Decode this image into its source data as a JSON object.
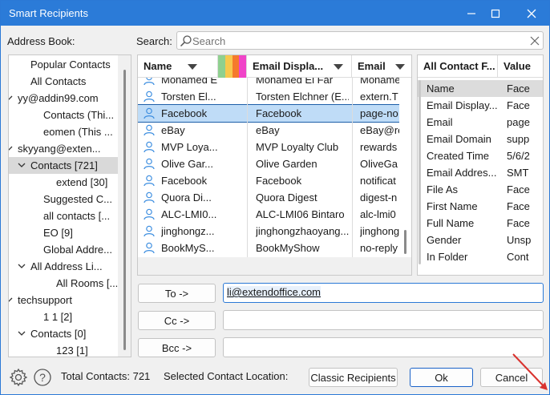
{
  "window": {
    "title": "Smart Recipients"
  },
  "labels": {
    "address_book": "Address Book:",
    "search": "Search:"
  },
  "search": {
    "placeholder": "Search",
    "value": ""
  },
  "tree": [
    {
      "label": "Popular Contacts",
      "chevron": ""
    },
    {
      "label": "All Contacts",
      "chevron": ""
    },
    {
      "label": "yy@addin99.com",
      "chevron": "v"
    },
    {
      "label": "Contacts (Thi...",
      "chevron": ""
    },
    {
      "label": "eomen (This ...",
      "chevron": ""
    },
    {
      "label": "skyyang@exten...",
      "chevron": "v"
    },
    {
      "label": "Contacts [721]",
      "chevron": "v"
    },
    {
      "label": "extend [30]",
      "chevron": ""
    },
    {
      "label": "Suggested C...",
      "chevron": ""
    },
    {
      "label": "all contacts [...",
      "chevron": ""
    },
    {
      "label": "EO [9]",
      "chevron": ""
    },
    {
      "label": "Global Addre...",
      "chevron": ""
    },
    {
      "label": "All Address Li...",
      "chevron": "v"
    },
    {
      "label": "All Rooms [...",
      "chevron": ""
    },
    {
      "label": "techsupport",
      "chevron": "v"
    },
    {
      "label": "1 1 [2]",
      "chevron": ""
    },
    {
      "label": "Contacts [0]",
      "chevron": "v"
    },
    {
      "label": "123 [1]",
      "chevron": ""
    }
  ],
  "grid": {
    "headers": [
      "Name",
      "Email Displa...",
      "Email"
    ],
    "rows": [
      [
        "Mohamed El...",
        "Mohamed El Far",
        "Mohame"
      ],
      [
        "Torsten El...",
        "Torsten Elchner (E...",
        "extern.T"
      ],
      [
        "Facebook",
        "Facebook",
        "page-no"
      ],
      [
        "eBay",
        "eBay",
        "eBay@re"
      ],
      [
        "MVP Loya...",
        "MVP Loyalty Club",
        "rewards"
      ],
      [
        "Olive Gar...",
        "Olive Garden",
        "OliveGa"
      ],
      [
        "Facebook",
        "Facebook",
        "notificat"
      ],
      [
        "Quora Di...",
        "Quora Digest",
        "digest-n"
      ],
      [
        "ALC-LMI0...",
        "ALC-LMI06 Bintaro",
        "alc-lmi0"
      ],
      [
        "jinghongz...",
        "jinghongzhaoyang...",
        "jinghong"
      ],
      [
        "BookMyS...",
        "BookMyShow",
        "no-reply"
      ]
    ]
  },
  "properties": {
    "headers": [
      "All Contact F...",
      "Value"
    ],
    "rows": [
      [
        "Name",
        "Face"
      ],
      [
        "Email Display...",
        "Face"
      ],
      [
        "Email",
        "page"
      ],
      [
        "Email Domain",
        "supp"
      ],
      [
        "Created Time",
        "5/6/2"
      ],
      [
        "Email Addres...",
        "SMT"
      ],
      [
        "File As",
        "Face"
      ],
      [
        "First Name",
        "Face"
      ],
      [
        "Full Name",
        "Face"
      ],
      [
        "Gender",
        "Unsp"
      ],
      [
        "In Folder",
        "Cont"
      ]
    ]
  },
  "recipients": {
    "to_label": "To ->",
    "cc_label": "Cc ->",
    "bcc_label": "Bcc ->",
    "to_value": "li@extendoffice.com",
    "cc_value": "",
    "bcc_value": ""
  },
  "footer": {
    "total": "Total Contacts: 721",
    "location": "Selected Contact Location:",
    "classic": "Classic Recipients",
    "ok": "Ok",
    "cancel": "Cancel"
  },
  "colors": {
    "titlebar": "#2b7bd8",
    "selection": "#bfdcf7",
    "accent": "#1a62c8"
  }
}
